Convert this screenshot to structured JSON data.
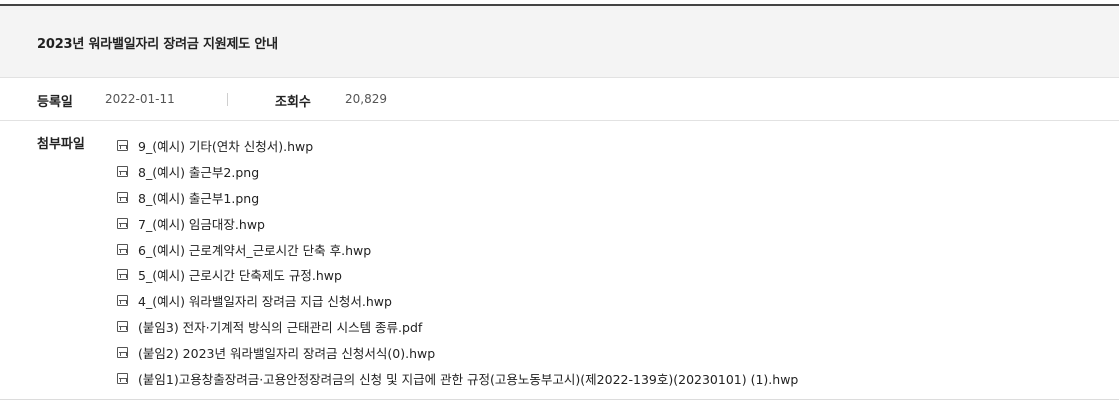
{
  "post": {
    "title": "2023년 워라밸일자리 장려금 지원제도 안내",
    "date_label": "등록일",
    "date_value": "2022-01-11",
    "views_label": "조회수",
    "views_value": "20,829",
    "attachments_label": "첨부파일"
  },
  "attachments": [
    {
      "name": "9_(예시) 기타(연차 신청서).hwp",
      "icon": "file-disk-icon"
    },
    {
      "name": "8_(예시) 출근부2.png",
      "icon": "file-disk-icon"
    },
    {
      "name": "8_(예시) 출근부1.png",
      "icon": "file-disk-icon"
    },
    {
      "name": "7_(예시) 임금대장.hwp",
      "icon": "file-disk-icon"
    },
    {
      "name": "6_(예시) 근로계약서_근로시간 단축 후.hwp",
      "icon": "file-disk-icon"
    },
    {
      "name": "5_(예시) 근로시간 단축제도 규정.hwp",
      "icon": "file-disk-icon"
    },
    {
      "name": "4_(예시) 워라밸일자리 장려금 지급 신청서.hwp",
      "icon": "file-disk-icon"
    },
    {
      "name": "(붙임3) 전자·기계적 방식의 근태관리 시스템 종류.pdf",
      "icon": "file-disk-icon"
    },
    {
      "name": "(붙임2) 2023년 워라밸일자리 장려금 신청서식(0).hwp",
      "icon": "file-disk-icon"
    },
    {
      "name": "(붙임1)고용창출장려금·고용안정장려금의 신청 및 지급에 관한 규정(고용노동부고시)(제2022-139호)(20230101) (1).hwp",
      "icon": "file-disk-icon"
    }
  ]
}
